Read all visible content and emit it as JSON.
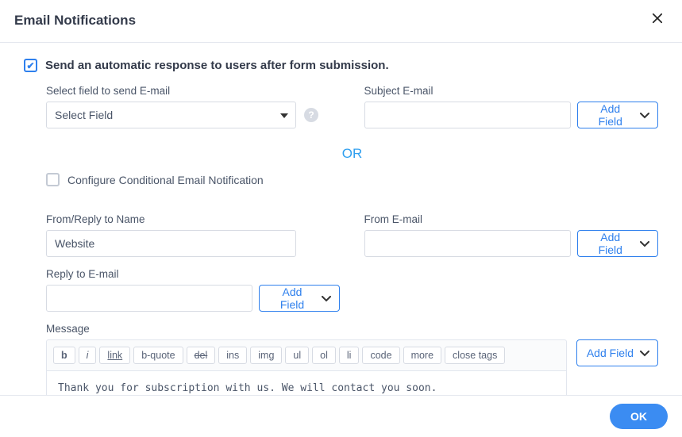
{
  "dialog": {
    "title": "Email Notifications",
    "ok": "OK"
  },
  "form": {
    "auto_response_label": "Send an automatic response to users after form submission.",
    "auto_response_checked": true,
    "select_field": {
      "label": "Select field to send E-mail",
      "value": "Select Field"
    },
    "subject": {
      "label": "Subject E-mail",
      "value": ""
    },
    "or_text": "OR",
    "conditional": {
      "label": "Configure Conditional Email Notification",
      "checked": false
    },
    "from_name": {
      "label": "From/Reply to Name",
      "value": "Website"
    },
    "from_email": {
      "label": "From E-mail",
      "value": ""
    },
    "reply_to": {
      "label": "Reply to E-mail",
      "value": ""
    },
    "message": {
      "label": "Message",
      "value": "Thank you for subscription with us. We will contact you soon."
    },
    "add_field_btn": "Add Field",
    "toolbar": [
      "b",
      "i",
      "link",
      "b-quote",
      "del",
      "ins",
      "img",
      "ul",
      "ol",
      "li",
      "code",
      "more",
      "close tags"
    ]
  }
}
